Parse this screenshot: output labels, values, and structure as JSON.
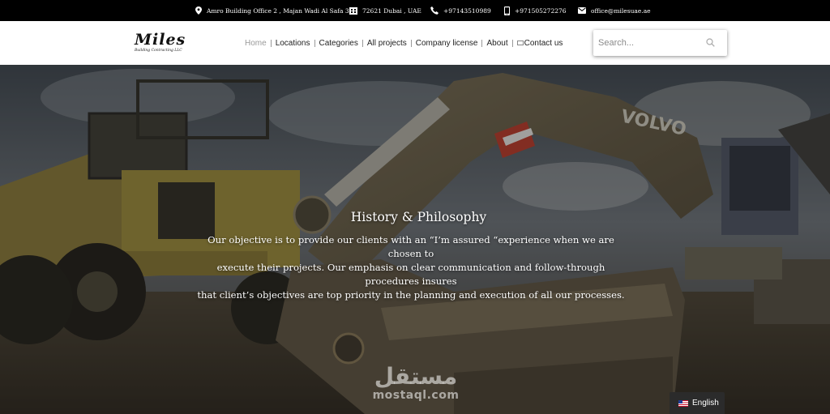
{
  "topbar": {
    "address": "Amro Building Office 2 , Majan Wadi Al Safa 3",
    "pobox": "72621 Dubai , UAE",
    "phone": "+97143510989",
    "mobile": "+971505272276",
    "email": "office@milesuae.ae",
    "icons": [
      "map-pin-icon",
      "building-icon",
      "phone-icon",
      "mobile-icon",
      "envelope-icon"
    ]
  },
  "header": {
    "logo_text": "Miles",
    "logo_tagline": "Building Contracting LLC",
    "nav": [
      {
        "label": "Home",
        "active": true
      },
      {
        "label": "Locations"
      },
      {
        "label": "Categories"
      },
      {
        "label": "All projects"
      },
      {
        "label": "Company license"
      },
      {
        "label": "About"
      },
      {
        "label": "Contact us",
        "icon": "mail-mini-icon"
      }
    ],
    "search": {
      "placeholder": "Search...",
      "icon": "search-icon"
    }
  },
  "hero": {
    "title": "History & Philosophy",
    "lines": [
      "Our objective is to provide our clients with an “I’m assured “experience when we are chosen to",
      "execute their projects. Our emphasis on clear communication and follow-through procedures insures",
      "that client’s objectives are top priority in the planning and execution of all our processes."
    ],
    "machine_text": "VOLVO"
  },
  "watermark": {
    "arabic": "مستقل",
    "latin": "mostaql.com"
  },
  "language": {
    "label": "English",
    "icon": "us-flag-icon"
  },
  "colors": {
    "topbar": "#000000",
    "header": "#ffffff",
    "nav_active": "#999999",
    "hero_overlay": "#1c1a16"
  }
}
